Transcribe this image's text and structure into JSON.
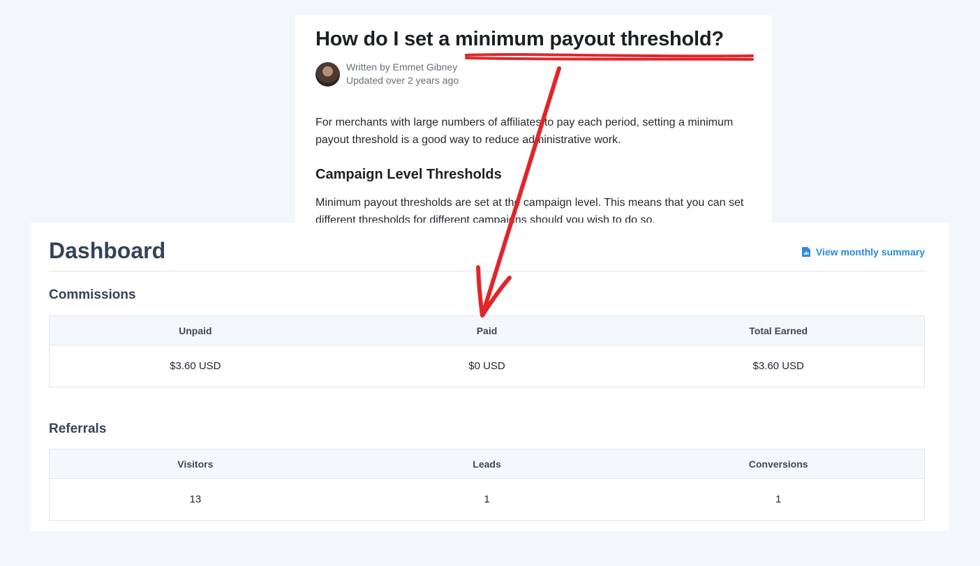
{
  "article": {
    "title_prefix": "How do I set a ",
    "title_highlight": "minimum payout threshold?",
    "author_line": "Written by Emmet Gibney",
    "updated_line": "Updated over 2 years ago",
    "intro": "For merchants with large numbers of affiliates to pay each period, setting a minimum payout threshold is a good way to reduce administrative work.",
    "section_heading": "Campaign Level Thresholds",
    "section_body": "Minimum payout thresholds are set at the campaign level. This means that you can set different thresholds for different campaigns should you wish to do so."
  },
  "dashboard": {
    "title": "Dashboard",
    "summary_link": "View monthly summary",
    "commissions": {
      "title": "Commissions",
      "headers": [
        "Unpaid",
        "Paid",
        "Total Earned"
      ],
      "values": [
        "$3.60 USD",
        "$0 USD",
        "$3.60 USD"
      ]
    },
    "referrals": {
      "title": "Referrals",
      "headers": [
        "Visitors",
        "Leads",
        "Conversions"
      ],
      "values": [
        "13",
        "1",
        "1"
      ]
    }
  },
  "annotation": {
    "color": "#e0262b",
    "underline_icon": "red-underline",
    "arrow_icon": "red-arrow"
  },
  "colors": {
    "page_bg": "#f3f7fc",
    "heading": "#34435a",
    "link": "#2a8ae0"
  }
}
